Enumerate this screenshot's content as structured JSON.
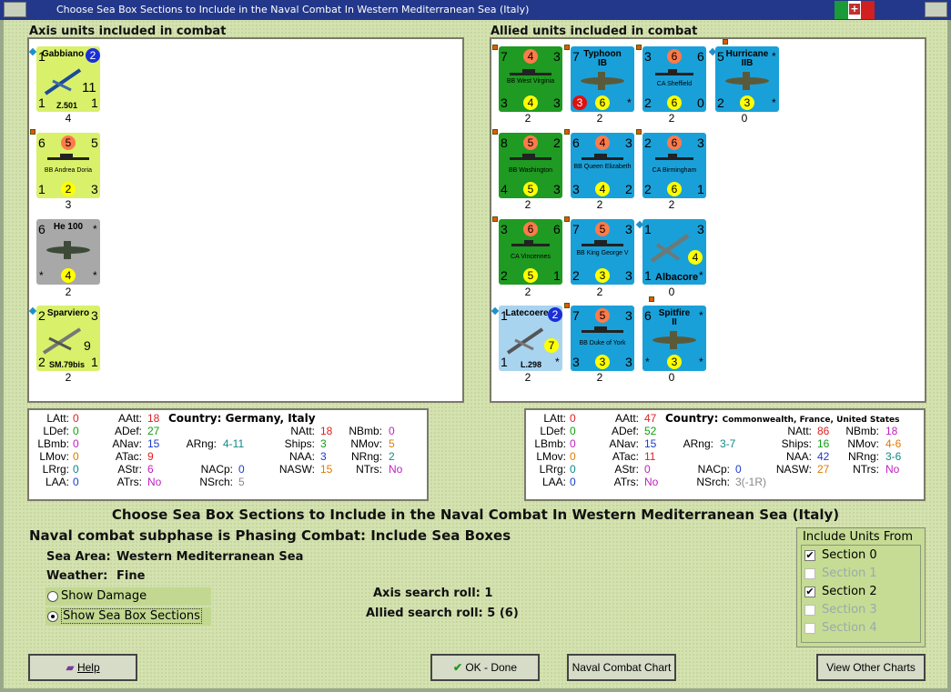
{
  "window": {
    "title": "Choose Sea Box Sections to Include in the Naval Combat In Western Mediterranean Sea (Italy)"
  },
  "axis": {
    "header": "Axis units included in combat",
    "units": [
      {
        "name": "Gabbiano",
        "sub": "Z.501",
        "tl": "1",
        "circle": "2",
        "big": "11",
        "bl": "1",
        "br": "1",
        "count": "4"
      },
      {
        "name": "BB Andrea Doria",
        "tl": "6",
        "tc": "5",
        "tr": "5",
        "bl": "1",
        "bc": "2",
        "br": "3",
        "count": "3"
      },
      {
        "name": "He 100",
        "tl": "6",
        "tr": "*",
        "bl": "*",
        "bc": "4",
        "br": "*",
        "count": "2"
      },
      {
        "name": "Sparviero",
        "sub": "SM.79bis",
        "tl": "2",
        "tr": "3",
        "big": "9",
        "bl": "2",
        "br": "1",
        "count": "2"
      }
    ]
  },
  "allied": {
    "header": "Allied units included in combat",
    "units": [
      {
        "name": "BB West Virginia",
        "tl": "7",
        "tc": "4",
        "tr": "3",
        "bl": "3",
        "bc": "4",
        "br": "3",
        "count": "2"
      },
      {
        "name": "Typhoon",
        "sub": "IB",
        "tl": "7",
        "bl": "3",
        "bc": "6",
        "br": "*",
        "count": "2"
      },
      {
        "name": "CA Sheffield",
        "tl": "3",
        "tc": "6",
        "tr": "6",
        "bl": "2",
        "bc": "6",
        "br": "0",
        "count": "2"
      },
      {
        "name": "Hurricane",
        "sub": "IIB",
        "tl": "5",
        "tr": "*",
        "bl": "2",
        "bc": "3",
        "br": "*",
        "count": "0"
      },
      {
        "name": "BB Washington",
        "tl": "8",
        "tc": "5",
        "tr": "2",
        "bl": "4",
        "bc": "5",
        "br": "3",
        "count": "2"
      },
      {
        "name": "BB Queen Elizabeth",
        "tl": "6",
        "tc": "4",
        "tr": "3",
        "bl": "3",
        "bc": "4",
        "br": "2",
        "count": "2"
      },
      {
        "name": "CA Birmingham",
        "tl": "2",
        "tc": "6",
        "tr": "3",
        "bl": "2",
        "bc": "6",
        "br": "1",
        "count": "2"
      },
      {
        "name": "CA Vincennes",
        "tl": "3",
        "tc": "6",
        "tr": "6",
        "bl": "2",
        "bc": "5",
        "br": "1",
        "count": "2"
      },
      {
        "name": "BB King George V",
        "tl": "7",
        "tc": "5",
        "tr": "3",
        "bl": "2",
        "bc": "3",
        "br": "3",
        "count": "2"
      },
      {
        "name": "Albacore",
        "tl": "1",
        "tr": "3",
        "big": "4",
        "bl": "1",
        "br": "*",
        "count": "0"
      },
      {
        "name": "Latecoere",
        "sub": "L.298",
        "tl": "1",
        "circle": "2",
        "big": "7",
        "bl": "1",
        "br": "*",
        "count": "2"
      },
      {
        "name": "BB Duke of York",
        "tl": "7",
        "tc": "5",
        "tr": "3",
        "bl": "3",
        "bc": "3",
        "br": "3",
        "count": "2"
      },
      {
        "name": "Spitfire",
        "sub": "II",
        "tl": "6",
        "tr": "*",
        "bl": "*",
        "bc": "3",
        "br": "*",
        "count": "0"
      }
    ]
  },
  "axis_stats": {
    "country_label": "Country:",
    "country": "Germany, Italy",
    "LAtt": "0",
    "LDef": "0",
    "LBmb": "0",
    "LMov": "0",
    "LRrg": "0",
    "LAA": "0",
    "AAtt": "18",
    "ADef": "27",
    "ANav": "15",
    "ATac": "9",
    "AStr": "6",
    "ATrs": "No",
    "ARng": "4-11",
    "NACp": "0",
    "NSrch": "5",
    "NAtt": "18",
    "Ships": "3",
    "NAA": "3",
    "NASW": "15",
    "NBmb": "0",
    "NMov": "5",
    "NRng": "2",
    "NTrs": "No"
  },
  "allied_stats": {
    "country_label": "Country:",
    "country": "Commonwealth, France, United States",
    "LAtt": "0",
    "LDef": "0",
    "LBmb": "0",
    "LMov": "0",
    "LRrg": "0",
    "LAA": "0",
    "AAtt": "47",
    "ADef": "52",
    "ANav": "15",
    "ATac": "11",
    "AStr": "0",
    "ATrs": "No",
    "ARng": "3-7",
    "NACp": "0",
    "NSrch": "3(-1R)",
    "NAtt": "86",
    "Ships": "16",
    "NAA": "42",
    "NASW": "27",
    "NBmb": "18",
    "NMov": "4-6",
    "NRng": "3-6",
    "NTrs": "No"
  },
  "labels": {
    "latt": "LAtt:",
    "ldef": "LDef:",
    "lbmb": "LBmb:",
    "lmov": "LMov:",
    "lrrg": "LRrg:",
    "laa": "LAA:",
    "aatt": "AAtt:",
    "adef": "ADef:",
    "anav": "ANav:",
    "atac": "ATac:",
    "astr": "AStr:",
    "atrs": "ATrs:",
    "arng": "ARng:",
    "nacp": "NACp:",
    "nsrch": "NSrch:",
    "natt": "NAtt:",
    "ships": "Ships:",
    "naa": "NAA:",
    "nasw": "NASW:",
    "nbmb": "NBmb:",
    "nmov": "NMov:",
    "nrng": "NRng:",
    "ntrs": "NTrs:"
  },
  "main": {
    "heading": "Choose Sea Box Sections to Include in the Naval Combat In Western Mediterranean Sea (Italy)",
    "subphase": "Naval combat subphase is Phasing Combat: Include Sea Boxes",
    "sea_area_label": "Sea Area:",
    "sea_area": "Western Mediterranean Sea",
    "weather_label": "Weather:",
    "weather": "Fine",
    "show_damage": "Show Damage",
    "show_sections": "Show Sea Box Sections",
    "axis_search": "Axis search roll:  1",
    "allied_search": "Allied search roll:  5 (6)"
  },
  "include": {
    "title": "Include Units From",
    "sections": [
      {
        "label": "Section 0",
        "checked": "✔"
      },
      {
        "label": "Section 1",
        "checked": ""
      },
      {
        "label": "Section 2",
        "checked": "✔"
      },
      {
        "label": "Section 3",
        "checked": ""
      },
      {
        "label": "Section 4",
        "checked": ""
      }
    ]
  },
  "buttons": {
    "help": "Help",
    "ok": "OK - Done",
    "chart": "Naval Combat Chart",
    "other": "View Other Charts"
  },
  "colors": {
    "green": "#1f9a22",
    "blue": "#1aa0d8",
    "light_blue": "#a8d4f0",
    "yellow_green": "#d9f06a",
    "gray": "#a8a8a8"
  }
}
